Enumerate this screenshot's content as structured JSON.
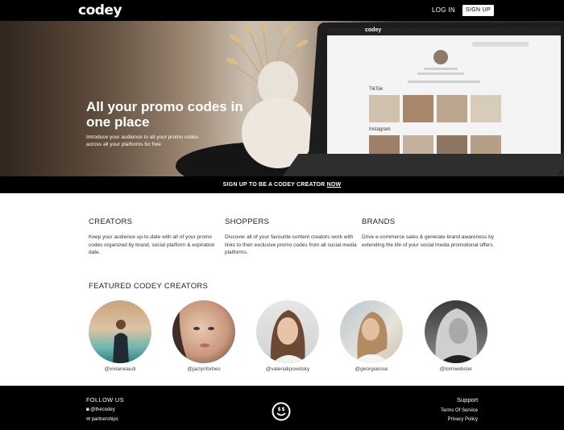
{
  "nav": {
    "logo": "codey",
    "login": "LOG IN",
    "signup": "SIGN UP"
  },
  "hero": {
    "title": "All your promo codes in one place",
    "subtitle": "Introduce your audience to all your promo codes across all your platforms for free",
    "screen": {
      "logo": "codey",
      "tiktok_label": "TikTok",
      "instagram_label": "Instagram"
    }
  },
  "cta": {
    "text": "SIGN UP TO BE A CODEY CREATOR ",
    "link": "NOW"
  },
  "columns": [
    {
      "title": "CREATORS",
      "body": "Keep your audience up-to-date with all of your promo codes organized by brand, social platform & expiration date."
    },
    {
      "title": "SHOPPERS",
      "body": "Discover all of your favourite content creators work with links to their exclusive promo codes from all social media platforms."
    },
    {
      "title": "BRANDS",
      "body": "Drive e-commerce sales & generate brand awareness by extending the life of your social media promotional offers."
    }
  ],
  "featured": {
    "title": "FEATURED CODEY CREATORS",
    "creators": [
      {
        "handle": "@vivianeaudi"
      },
      {
        "handle": "@jaclynforbes"
      },
      {
        "handle": "@valerialipovetsky"
      },
      {
        "handle": "@georgiarose"
      },
      {
        "handle": "@torriwebster"
      }
    ]
  },
  "footer": {
    "follow_us": "FOLLOW US",
    "instagram": "@thecodey",
    "email": "partnerships",
    "support": "Support",
    "terms": "Terms Of Service",
    "privacy": "Privacy Policy"
  },
  "colors": {
    "background": "#ffffff",
    "nav": "#000000",
    "footer": "#000000",
    "text": "#222222"
  }
}
